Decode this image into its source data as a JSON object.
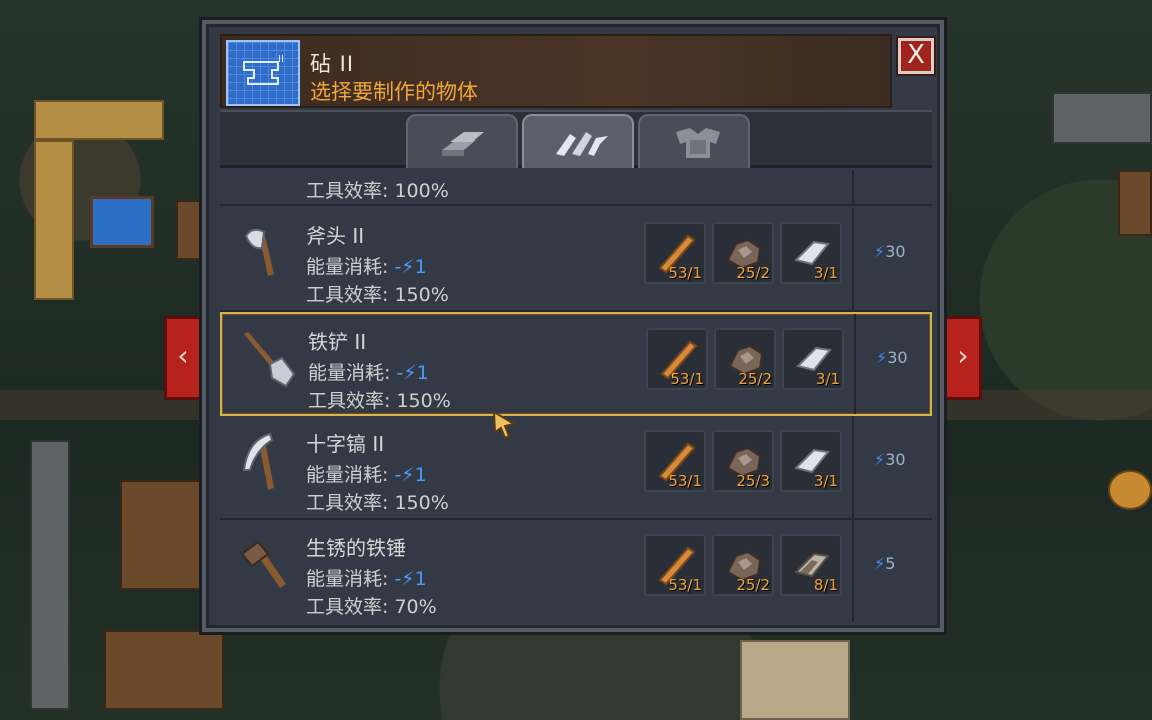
{
  "window": {
    "title": "砧 II",
    "subtitle": "选择要制作的物体",
    "close_label": "X"
  },
  "tabs": [
    {
      "icon": "ingot-stack-icon"
    },
    {
      "icon": "tools-icon"
    },
    {
      "icon": "armor-icon"
    }
  ],
  "partial_row": {
    "stat": "工具效率: 100%"
  },
  "rows": [
    {
      "name": "斧头 II",
      "energy_label": "能量消耗:",
      "energy_value": "-⚡1",
      "efficiency": "工具效率: 150%",
      "icon": "axe-icon",
      "ingredients": [
        {
          "icon": "wood-icon",
          "count": "53/1"
        },
        {
          "icon": "ore-icon",
          "count": "25/2"
        },
        {
          "icon": "iron-bar-icon",
          "count": "3/1"
        }
      ],
      "cost_bolt": "⚡",
      "cost": "30"
    },
    {
      "name": "铁铲 II",
      "energy_label": "能量消耗:",
      "energy_value": "-⚡1",
      "efficiency": "工具效率: 150%",
      "icon": "shovel-icon",
      "ingredients": [
        {
          "icon": "wood-icon",
          "count": "53/1"
        },
        {
          "icon": "ore-icon",
          "count": "25/2"
        },
        {
          "icon": "iron-bar-icon",
          "count": "3/1"
        }
      ],
      "cost_bolt": "⚡",
      "cost": "30"
    },
    {
      "name": "十字镐 II",
      "energy_label": "能量消耗:",
      "energy_value": "-⚡1",
      "efficiency": "工具效率: 150%",
      "icon": "pickaxe-icon",
      "ingredients": [
        {
          "icon": "wood-icon",
          "count": "53/1"
        },
        {
          "icon": "ore-icon",
          "count": "25/3"
        },
        {
          "icon": "iron-bar-icon",
          "count": "3/1"
        }
      ],
      "cost_bolt": "⚡",
      "cost": "30"
    },
    {
      "name": "生锈的铁锤",
      "energy_label": "能量消耗:",
      "energy_value": "-⚡1",
      "efficiency": "工具效率: 70%",
      "icon": "hammer-icon",
      "ingredients": [
        {
          "icon": "wood-icon",
          "count": "53/1"
        },
        {
          "icon": "ore-icon",
          "count": "25/2"
        },
        {
          "icon": "rusty-bar-icon",
          "count": "8/1"
        }
      ],
      "cost_bolt": "⚡",
      "cost": "5"
    }
  ],
  "nav": {
    "prev": "‹",
    "next": "›"
  }
}
